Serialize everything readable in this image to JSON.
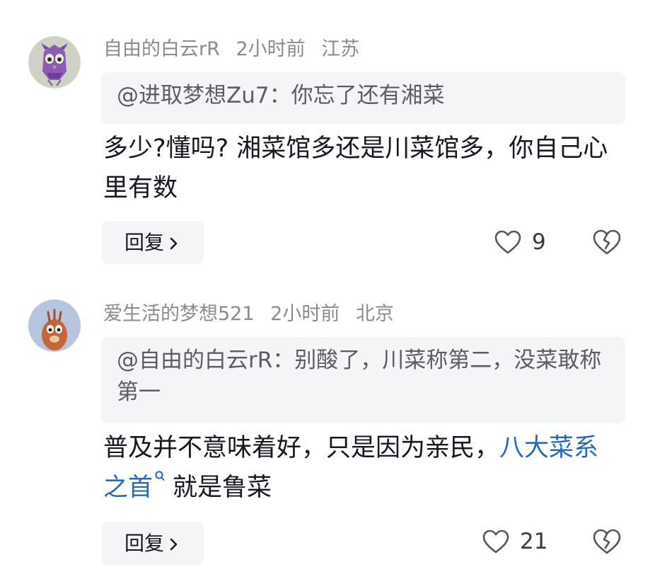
{
  "comments": [
    {
      "author": "自由的白云rR",
      "time": "2小时前",
      "location": "江苏",
      "quote": "@进取梦想Zu7：你忘了还有湘菜",
      "text": "多少?懂吗? 湘菜馆多还是川菜馆多，你自己心里有数",
      "reply_label": "回复",
      "like_count": "9",
      "avatar_icon": "cartoon-owl-avatar"
    },
    {
      "author": "爱生活的梦想521",
      "time": "2小时前",
      "location": "北京",
      "quote": "@自由的白云rR：别酸了，川菜称第二，没菜敢称第一",
      "text_before_link": "普及并不意味着好，只是因为亲民，",
      "link_text": "八大菜系之首",
      "text_after_link": "就是鲁菜",
      "reply_label": "回复",
      "like_count": "21",
      "avatar_icon": "cartoon-creature-avatar"
    }
  ],
  "colors": {
    "meta_text": "#8a8b91",
    "body_text": "#161823",
    "quote_background": "#f4f5f7",
    "quote_text": "#5b5d66",
    "link": "#2a68b4"
  },
  "icons": {
    "like": "heart-outline-icon",
    "dislike": "broken-heart-icon",
    "reply_chevron": "chevron-right-icon",
    "link_search": "search-icon"
  }
}
